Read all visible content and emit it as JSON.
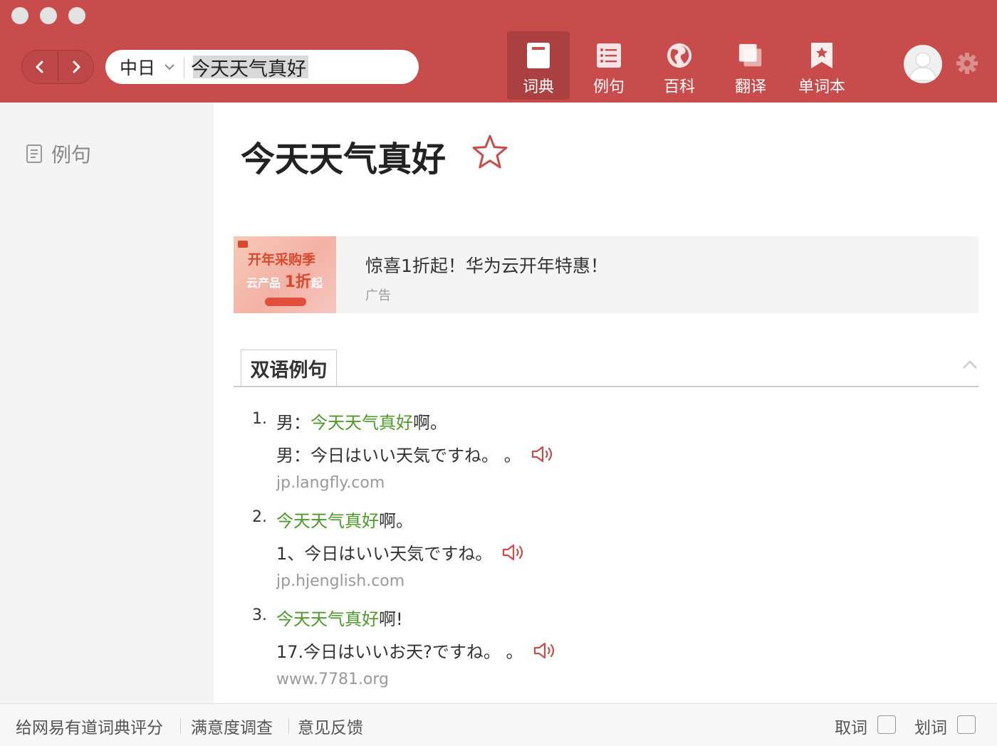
{
  "toolbar": {
    "lang": "中日",
    "query": "今天天气真好",
    "tabs": [
      {
        "label": "词典",
        "icon": "dictionary-icon"
      },
      {
        "label": "例句",
        "icon": "list-icon"
      },
      {
        "label": "百科",
        "icon": "globe-icon"
      },
      {
        "label": "翻译",
        "icon": "translate-icon"
      },
      {
        "label": "单词本",
        "icon": "bookmark-icon"
      }
    ],
    "active_tab": "词典"
  },
  "sidebar": {
    "items": [
      {
        "label": "例句",
        "icon": "document-icon"
      }
    ]
  },
  "main": {
    "word": "今天天气真好",
    "ad": {
      "title": "惊喜1折起！华为云开年特惠！",
      "tag": "广告",
      "image_text_1": "开年采购季",
      "image_text_2": "云产品",
      "image_text_2b": "1折",
      "image_text_2c": "起"
    },
    "section_title": "双语例句",
    "examples": [
      {
        "num": "1.",
        "prefix": "男：",
        "highlight": "今天天气真好",
        "suffix": "啊。",
        "translation": "男：今日はいい天気ですね。 。",
        "source": "jp.langfly.com"
      },
      {
        "num": "2.",
        "prefix": "",
        "highlight": "今天天气真好",
        "suffix": "啊。",
        "translation": "1、今日はいい天気ですね。",
        "source": "jp.hjenglish.com"
      },
      {
        "num": "3.",
        "prefix": "",
        "highlight": "今天天气真好",
        "suffix": "啊!",
        "translation": "17.今日はいいお天?ですね。 。",
        "source": "www.7781.org"
      }
    ]
  },
  "footer": {
    "links": [
      "给网易有道词典评分",
      "满意度调查",
      "意见反馈"
    ],
    "quword": "取词",
    "huaci": "划词"
  },
  "colors": {
    "accent": "#c94c4c",
    "highlight_green": "#4c9a2a",
    "traffic_light": "#e3e3e3"
  }
}
